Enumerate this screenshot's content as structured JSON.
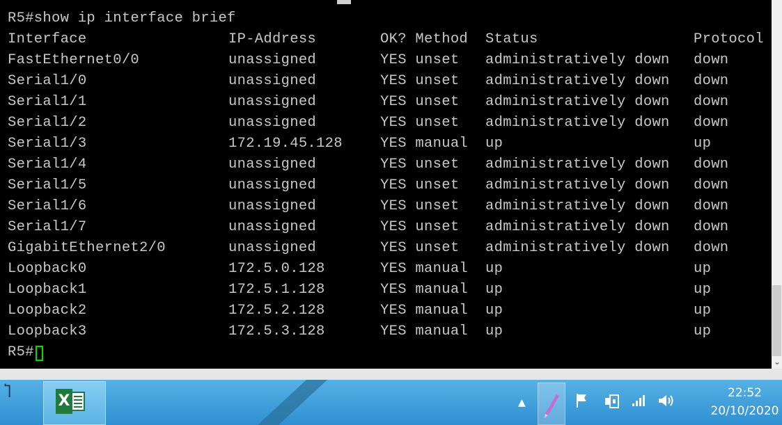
{
  "terminal": {
    "command_line": "R5#show ip interface brief",
    "headers": [
      "Interface",
      "IP-Address",
      "OK? Method",
      "Status",
      "Protocol"
    ],
    "rows": [
      [
        "FastEthernet0/0",
        "unassigned",
        "YES unset",
        "administratively down",
        "down"
      ],
      [
        "Serial1/0",
        "unassigned",
        "YES unset",
        "administratively down",
        "down"
      ],
      [
        "Serial1/1",
        "unassigned",
        "YES unset",
        "administratively down",
        "down"
      ],
      [
        "Serial1/2",
        "unassigned",
        "YES unset",
        "administratively down",
        "down"
      ],
      [
        "Serial1/3",
        "172.19.45.128",
        "YES manual",
        "up",
        "up"
      ],
      [
        "Serial1/4",
        "unassigned",
        "YES unset",
        "administratively down",
        "down"
      ],
      [
        "Serial1/5",
        "unassigned",
        "YES unset",
        "administratively down",
        "down"
      ],
      [
        "Serial1/6",
        "unassigned",
        "YES unset",
        "administratively down",
        "down"
      ],
      [
        "Serial1/7",
        "unassigned",
        "YES unset",
        "administratively down",
        "down"
      ],
      [
        "GigabitEthernet2/0",
        "unassigned",
        "YES unset",
        "administratively down",
        "down"
      ],
      [
        "Loopback0",
        "172.5.0.128",
        "YES manual",
        "up",
        "up"
      ],
      [
        "Loopback1",
        "172.5.1.128",
        "YES manual",
        "up",
        "up"
      ],
      [
        "Loopback2",
        "172.5.2.128",
        "YES manual",
        "up",
        "up"
      ],
      [
        "Loopback3",
        "172.5.3.128",
        "YES manual",
        "up",
        "up"
      ]
    ],
    "prompt": "R5#",
    "colors": {
      "background": "#000000",
      "text": "#c8c8c8",
      "cursor": "#00e000"
    }
  },
  "scrollbar": {
    "down_arrow": "⌄"
  },
  "taskbar": {
    "left_icon": "Ⴈ",
    "pinned_app": "excel-icon",
    "tray": {
      "icons": [
        "show-hidden-icons-arrow",
        "pen-icon",
        "flag-icon",
        "network-adapter-icon",
        "signal-icon",
        "volume-icon"
      ],
      "arrow_glyph": "▲",
      "flag_glyph": "⚑",
      "signal_glyph": "📶",
      "volume_glyph": "🔊"
    },
    "clock": {
      "time": "22:52",
      "date": "20/10/2020"
    },
    "colors": {
      "gradient_top": "#56b2e6",
      "gradient_bottom": "#2f8fd0"
    }
  }
}
